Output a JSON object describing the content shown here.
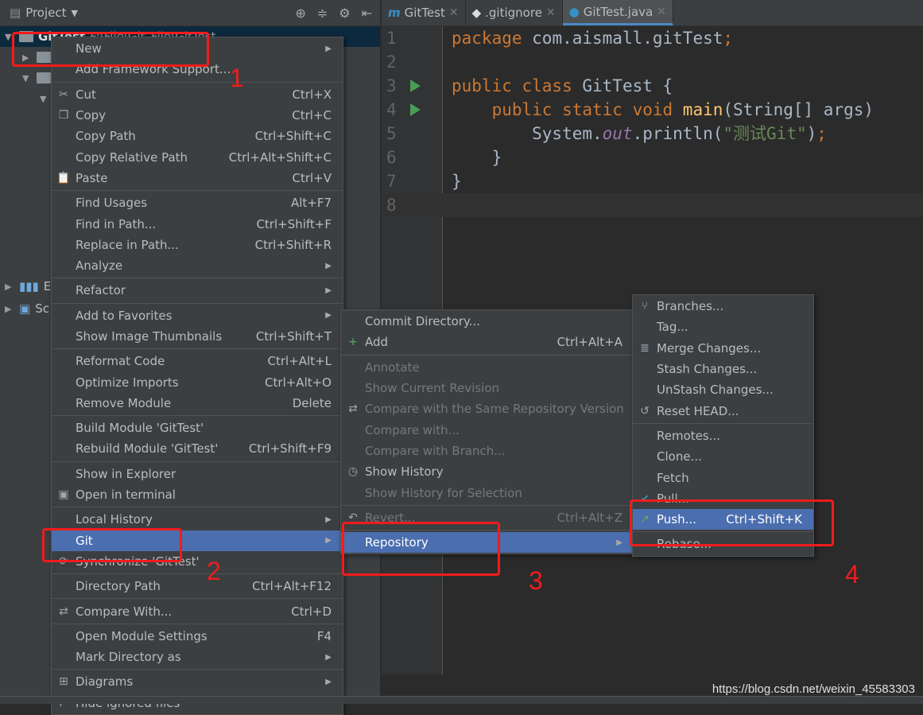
{
  "project_panel": {
    "title": "Project",
    "root": "GitTest",
    "root_path": "F:\\File\\Git_File\\GitTest",
    "partial_items": [
      "Ex",
      "Sc"
    ]
  },
  "editor": {
    "tabs": [
      {
        "label": "GitTest",
        "icon": "maven-icon"
      },
      {
        "label": ".gitignore",
        "icon": "git-icon"
      },
      {
        "label": "GitTest.java",
        "icon": "java-class-icon",
        "active": true
      }
    ],
    "lines": [
      [
        [
          "package ",
          "kw"
        ],
        [
          "com.aismall.gitTest",
          "pl"
        ],
        [
          ";",
          "kw"
        ]
      ],
      [],
      [
        [
          "public class ",
          "kw"
        ],
        [
          "GitTest {",
          "pl"
        ]
      ],
      [
        [
          "    public static void ",
          "kw"
        ],
        [
          "main",
          "fn"
        ],
        [
          "(String[] args)",
          "pl"
        ]
      ],
      [
        [
          "        System.",
          "pl"
        ],
        [
          "out",
          "fi"
        ],
        [
          ".println(",
          "pl"
        ],
        [
          "\"测试Git\"",
          "st"
        ],
        [
          ")",
          "pl"
        ],
        [
          ";",
          "kw"
        ]
      ],
      [
        [
          "    }",
          "pl"
        ]
      ],
      [
        [
          "}",
          "pl"
        ]
      ],
      []
    ]
  },
  "context_menu": [
    {
      "label": "New",
      "submenu": true
    },
    {
      "label": "Add Framework Support..."
    },
    {
      "sep": true
    },
    {
      "label": "Cut",
      "shortcut": "Ctrl+X",
      "icon": "✂"
    },
    {
      "label": "Copy",
      "shortcut": "Ctrl+C",
      "icon": "❐"
    },
    {
      "label": "Copy Path",
      "shortcut": "Ctrl+Shift+C"
    },
    {
      "label": "Copy Relative Path",
      "shortcut": "Ctrl+Alt+Shift+C"
    },
    {
      "label": "Paste",
      "shortcut": "Ctrl+V",
      "icon": "📋"
    },
    {
      "sep": true
    },
    {
      "label": "Find Usages",
      "shortcut": "Alt+F7"
    },
    {
      "label": "Find in Path...",
      "shortcut": "Ctrl+Shift+F"
    },
    {
      "label": "Replace in Path...",
      "shortcut": "Ctrl+Shift+R"
    },
    {
      "label": "Analyze",
      "submenu": true
    },
    {
      "sep": true
    },
    {
      "label": "Refactor",
      "submenu": true
    },
    {
      "sep": true
    },
    {
      "label": "Add to Favorites",
      "submenu": true
    },
    {
      "label": "Show Image Thumbnails",
      "shortcut": "Ctrl+Shift+T"
    },
    {
      "sep": true
    },
    {
      "label": "Reformat Code",
      "shortcut": "Ctrl+Alt+L"
    },
    {
      "label": "Optimize Imports",
      "shortcut": "Ctrl+Alt+O"
    },
    {
      "label": "Remove Module",
      "shortcut": "Delete"
    },
    {
      "sep": true
    },
    {
      "label": "Build Module 'GitTest'"
    },
    {
      "label": "Rebuild Module 'GitTest'",
      "shortcut": "Ctrl+Shift+F9"
    },
    {
      "sep": true
    },
    {
      "label": "Show in Explorer"
    },
    {
      "label": "Open in terminal",
      "icon": "▣"
    },
    {
      "sep": true
    },
    {
      "label": "Local History",
      "submenu": true
    },
    {
      "label": "Git",
      "submenu": true,
      "highlighted": true
    },
    {
      "label": "Synchronize 'GitTest'",
      "icon": "⟳"
    },
    {
      "sep": true
    },
    {
      "label": "Directory Path",
      "shortcut": "Ctrl+Alt+F12"
    },
    {
      "sep": true
    },
    {
      "label": "Compare With...",
      "shortcut": "Ctrl+D",
      "icon": "⇄"
    },
    {
      "sep": true
    },
    {
      "label": "Open Module Settings",
      "shortcut": "F4"
    },
    {
      "label": "Mark Directory as",
      "submenu": true
    },
    {
      "sep": true
    },
    {
      "label": "Diagrams",
      "submenu": true,
      "icon": "⊞"
    },
    {
      "label": "Hide ignored files",
      "icon": "i*"
    }
  ],
  "git_menu": [
    {
      "label": "Commit Directory..."
    },
    {
      "label": "Add",
      "shortcut": "Ctrl+Alt+A",
      "icon": "+"
    },
    {
      "sep": true
    },
    {
      "label": "Annotate",
      "disabled": true
    },
    {
      "label": "Show Current Revision",
      "disabled": true
    },
    {
      "label": "Compare with the Same Repository Version",
      "disabled": true,
      "icon": "⇄"
    },
    {
      "label": "Compare with...",
      "disabled": true
    },
    {
      "label": "Compare with Branch...",
      "disabled": true
    },
    {
      "label": "Show History",
      "icon": "◷"
    },
    {
      "label": "Show History for Selection",
      "disabled": true
    },
    {
      "sep": true
    },
    {
      "label": "Revert...",
      "shortcut": "Ctrl+Alt+Z",
      "disabled": true,
      "icon": "↶"
    },
    {
      "sep": true
    },
    {
      "label": "Repository",
      "submenu": true,
      "highlighted": true
    }
  ],
  "repository_menu": [
    {
      "label": "Branches...",
      "icon": "⑂"
    },
    {
      "label": "Tag..."
    },
    {
      "label": "Merge Changes...",
      "icon": "≣"
    },
    {
      "label": "Stash Changes..."
    },
    {
      "label": "UnStash Changes..."
    },
    {
      "label": "Reset HEAD...",
      "icon": "↺"
    },
    {
      "sep": true
    },
    {
      "label": "Remotes..."
    },
    {
      "label": "Clone..."
    },
    {
      "label": "Fetch"
    },
    {
      "label": "Pull...",
      "icon": "↙"
    },
    {
      "label": "Push...",
      "shortcut": "Ctrl+Shift+K",
      "icon": "↗",
      "highlighted": true
    },
    {
      "sep": true
    },
    {
      "label": "Rebase..."
    }
  ],
  "annotations": [
    "1",
    "2",
    "3",
    "4"
  ],
  "watermark": "https://blog.csdn.net/weixin_45583303",
  "colors": {
    "highlight": "#4b6eaf",
    "annotation": "#f01c1c",
    "keyword": "#cc7832",
    "string": "#6a8759"
  }
}
